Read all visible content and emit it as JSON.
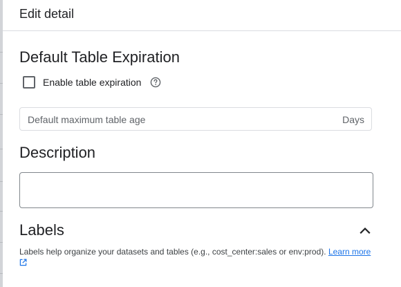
{
  "header": {
    "title": "Edit detail"
  },
  "expiration": {
    "title": "Default Table Expiration",
    "checkbox_label": "Enable table expiration",
    "checkbox_checked": false,
    "help_icon": "help-circle-icon",
    "max_age_placeholder": "Default maximum table age",
    "max_age_suffix": "Days"
  },
  "description": {
    "title": "Description",
    "value": ""
  },
  "labels": {
    "title": "Labels",
    "expanded": true,
    "collapse_icon": "chevron-up-icon",
    "help_text": "Labels help organize your datasets and tables (e.g., cost_center:sales or env:prod). ",
    "learn_more_label": "Learn more",
    "external_icon": "open-in-new-icon"
  },
  "colors": {
    "text_primary": "#202124",
    "text_secondary": "#5f6368",
    "link": "#1a73e8",
    "border": "#dadce0"
  }
}
